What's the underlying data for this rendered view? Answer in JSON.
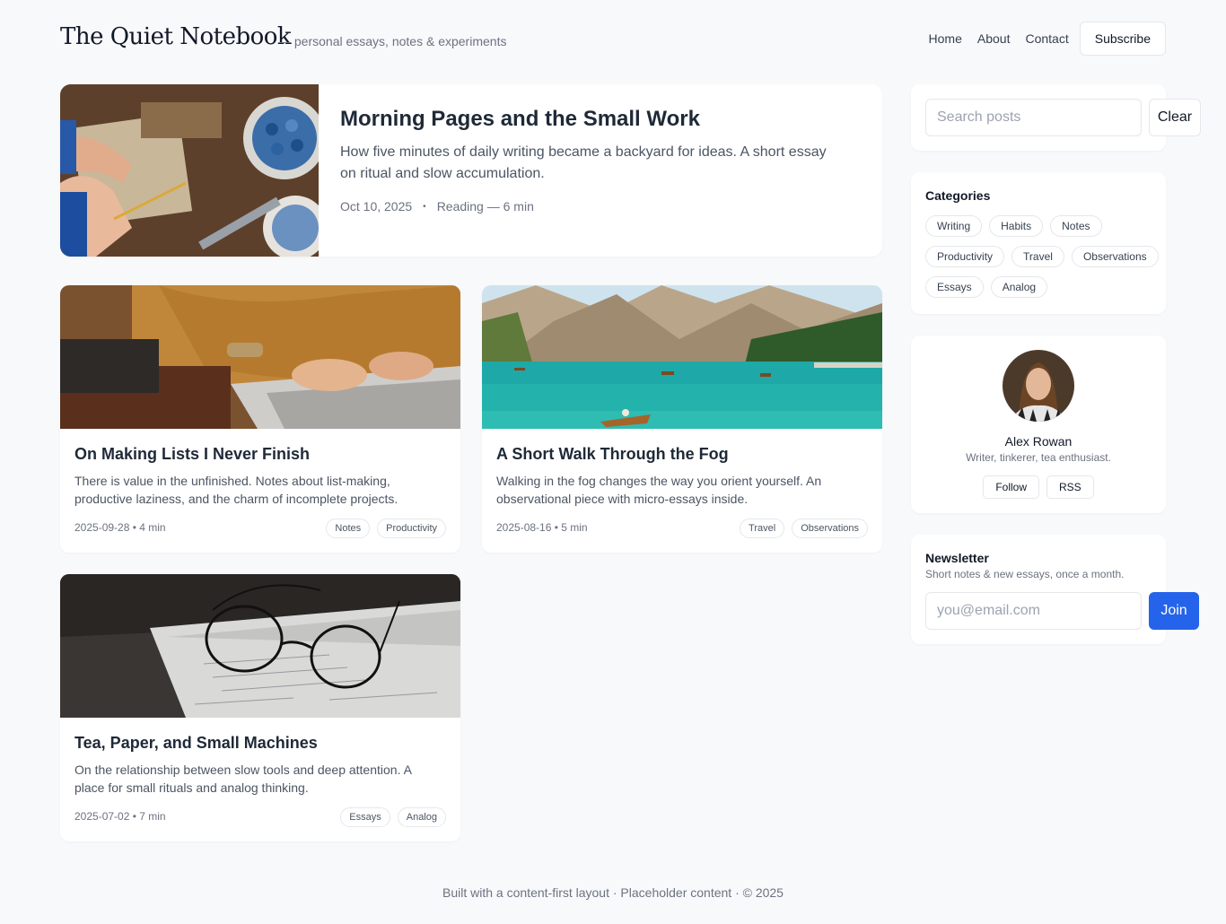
{
  "header": {
    "brand": "The Quiet Notebook",
    "tagline": "— personal essays, notes & experiments",
    "nav": [
      "Home",
      "About",
      "Contact"
    ],
    "subscribe_label": "Subscribe"
  },
  "featured": {
    "title": "Morning Pages and the Small Work",
    "excerpt": "How five minutes of daily writing became a backyard for ideas. A short essay on ritual and slow accumulation.",
    "date": "Oct 10, 2025",
    "separator": "•",
    "reading": "Reading — 6 min",
    "image": "workbench-hands-photo"
  },
  "posts": [
    {
      "title": "On Making Lists I Never Finish",
      "excerpt": "There is value in the unfinished. Notes about list-making, productive laziness, and the charm of incomplete projects.",
      "meta": "2025-09-28 • 4 min",
      "tags": [
        "Notes",
        "Productivity"
      ],
      "image": "laptop-typing-photo"
    },
    {
      "title": "A Short Walk Through the Fog",
      "excerpt": "Walking in the fog changes the way you orient yourself. An observational piece with micro-essays inside.",
      "meta": "2025-08-16 • 5 min",
      "tags": [
        "Travel",
        "Observations"
      ],
      "image": "mountain-lake-photo"
    },
    {
      "title": "Tea, Paper, and Small Machines",
      "excerpt": "On the relationship between slow tools and deep attention. A place for small rituals and analog thinking.",
      "meta": "2025-07-02 • 7 min",
      "tags": [
        "Essays",
        "Analog"
      ],
      "image": "eyeglasses-on-notes-photo"
    }
  ],
  "search": {
    "placeholder": "Search posts",
    "clear_label": "Clear"
  },
  "categories": {
    "heading": "Categories",
    "items": [
      "Writing",
      "Habits",
      "Notes",
      "Productivity",
      "Travel",
      "Observations",
      "Essays",
      "Analog"
    ]
  },
  "author": {
    "name": "Alex Rowan",
    "bio": "Writer, tinkerer, tea enthusiast.",
    "follow_label": "Follow",
    "rss_label": "RSS"
  },
  "newsletter": {
    "heading": "Newsletter",
    "subtitle": "Short notes & new essays, once a month.",
    "placeholder": "you@email.com",
    "join_label": "Join"
  },
  "footer": {
    "text": "Built with a content-first layout · Placeholder content · © 2025"
  },
  "colors": {
    "accent": "#2563eb",
    "background": "#f8f9fb"
  }
}
